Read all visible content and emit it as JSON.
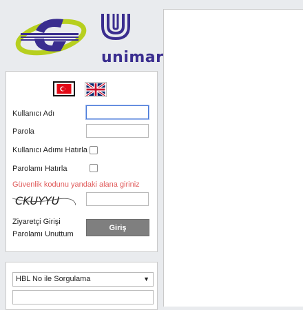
{
  "brand": {
    "name": "unimar",
    "mark": "®"
  },
  "login": {
    "lang_tr_icon": "flag-tr-icon",
    "lang_en_icon": "flag-uk-icon",
    "username_label": "Kullanıcı Adı",
    "username_value": "",
    "password_label": "Parola",
    "password_value": "",
    "remember_user_label": "Kullanıcı Adımı Hatırla",
    "remember_password_label": "Parolamı Hatırla",
    "captcha_hint": "Güvenlik kodunu yandaki alana giriniz",
    "captcha_text": "CKUYYU",
    "captcha_value": "",
    "guest_login_link": "Ziyaretçi Girişi",
    "forgot_password_link": "Parolamı Unuttum",
    "submit_label": "Giriş"
  },
  "query": {
    "select_value": "HBL No ile Sorgulama",
    "input_value": ""
  },
  "colors": {
    "brand_purple": "#3a2d8f",
    "brand_green": "#b7cf1f",
    "hint_red": "#e05b5b",
    "button_gray": "#7f7f7f"
  }
}
